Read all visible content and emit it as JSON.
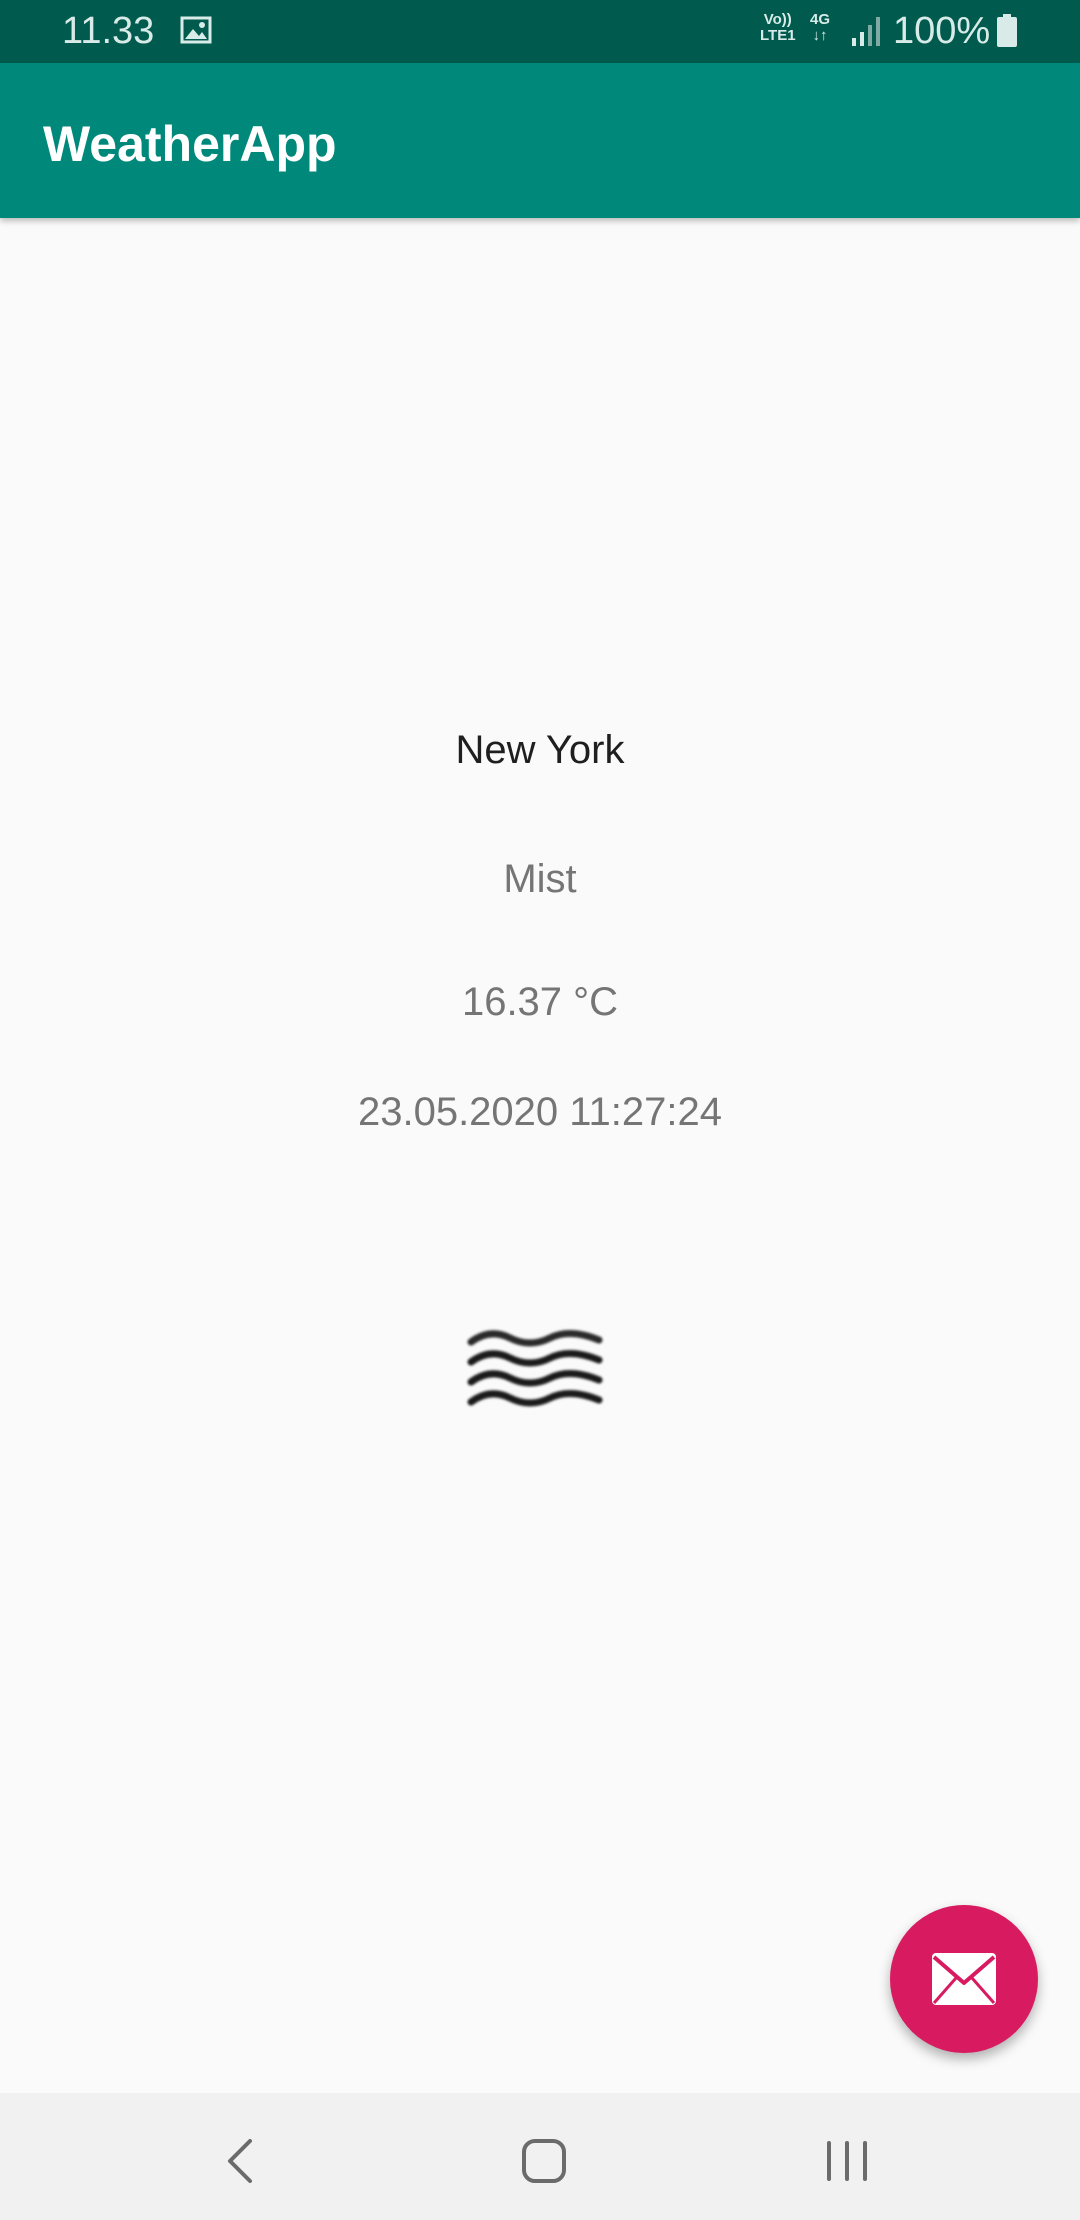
{
  "status_bar": {
    "time": "11.33",
    "volte_line1": "Vo))",
    "volte_line2": "LTE1",
    "network": "4G",
    "network_arrows": "↓↑",
    "battery": "100%",
    "icons": [
      "gallery-icon",
      "signal-icon",
      "battery-icon"
    ]
  },
  "app_bar": {
    "title": "WeatherApp"
  },
  "weather": {
    "city": "New York",
    "description": "Mist",
    "temperature": "16.37 °C",
    "timestamp": "23.05.2020 11:27:24",
    "icon": "mist-icon"
  },
  "fab": {
    "icon": "mail-icon"
  },
  "nav_bar": {
    "icons": [
      "back-icon",
      "home-icon",
      "recent-apps-icon"
    ]
  },
  "colors": {
    "status_bar": "#005b4e",
    "app_bar": "#00897b",
    "fab": "#d81b60",
    "background": "#fafafa",
    "nav_bar": "#f1f1f1"
  }
}
